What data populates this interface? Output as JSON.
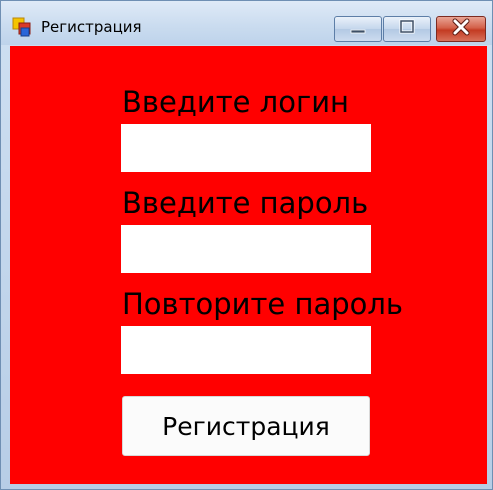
{
  "window": {
    "title": "Регистрация",
    "controls": {
      "minimize": "minimize-icon",
      "maximize": "maximize-icon",
      "close": "close-icon"
    },
    "background_color": "#ff0000"
  },
  "form": {
    "login_label": "Введите логин",
    "login_value": "",
    "password_label": "Введите пароль",
    "password_value": "",
    "repeat_password_label": "Повторите пароль",
    "repeat_password_value": "",
    "submit_label": "Регистрация"
  }
}
